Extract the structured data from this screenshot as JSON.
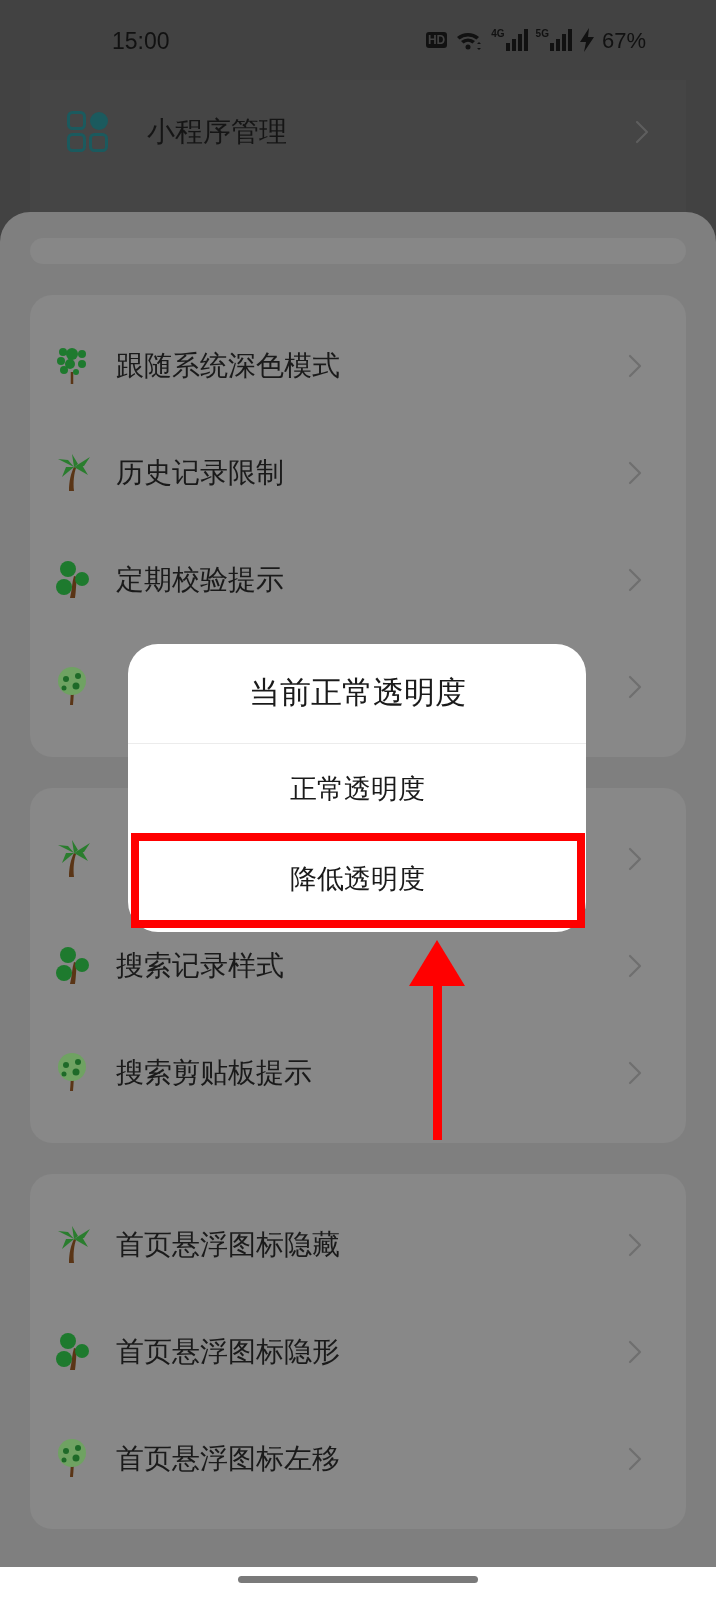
{
  "status_bar": {
    "time": "15:00",
    "hd": "HD",
    "networks": [
      "4G",
      "5G"
    ],
    "charging": true,
    "battery": "67%"
  },
  "background_item": {
    "label": "小程序管理"
  },
  "sheet": {
    "groups": [
      {
        "items": [
          {
            "kind": "labeled",
            "label": "跟随系统深色模式"
          },
          {
            "kind": "labeled",
            "label": "历史记录限制"
          },
          {
            "kind": "labeled",
            "label": "定期校验提示"
          },
          {
            "kind": "covered"
          }
        ]
      },
      {
        "items": [
          {
            "kind": "covered"
          },
          {
            "kind": "labeled",
            "label": "搜索记录样式"
          },
          {
            "kind": "labeled",
            "label": "搜索剪贴板提示"
          }
        ]
      },
      {
        "items": [
          {
            "kind": "labeled",
            "label": "首页悬浮图标隐藏"
          },
          {
            "kind": "labeled",
            "label": "首页悬浮图标隐形"
          },
          {
            "kind": "labeled",
            "label": "首页悬浮图标左移"
          }
        ]
      }
    ]
  },
  "dialog": {
    "title": "当前正常透明度",
    "options": [
      {
        "label": "正常透明度",
        "highlighted": false
      },
      {
        "label": "降低透明度",
        "highlighted": true
      }
    ]
  }
}
